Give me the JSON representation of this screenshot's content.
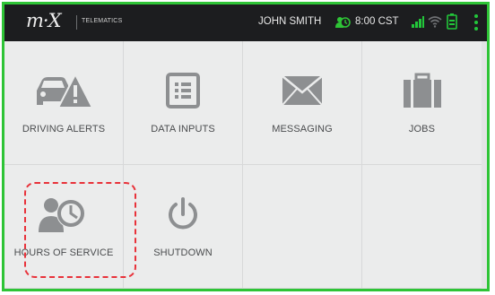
{
  "header": {
    "logo_text": "m·X",
    "logo_subtitle": "TELEMATICS",
    "user_name": "JOHN SMITH",
    "time": "8:00 CST",
    "icons": [
      "clock-person-icon",
      "signal-icon",
      "wifi-icon",
      "battery-icon",
      "overflow-menu-icon"
    ],
    "accent_color": "#22c73a"
  },
  "tiles": [
    {
      "label": "DRIVING ALERTS",
      "icon": "car-warning-icon"
    },
    {
      "label": "DATA INPUTS",
      "icon": "list-icon"
    },
    {
      "label": "MESSAGING",
      "icon": "envelope-icon"
    },
    {
      "label": "JOBS",
      "icon": "briefcase-icon"
    },
    {
      "label": "HOURS OF SERVICE",
      "icon": "driver-clock-icon"
    },
    {
      "label": "SHUTDOWN",
      "icon": "power-icon"
    },
    {
      "label": "",
      "icon": ""
    },
    {
      "label": "",
      "icon": ""
    }
  ],
  "colors": {
    "frame": "#2ec436",
    "highlight": "#e8323a",
    "icon_gray": "#8d8f91"
  }
}
